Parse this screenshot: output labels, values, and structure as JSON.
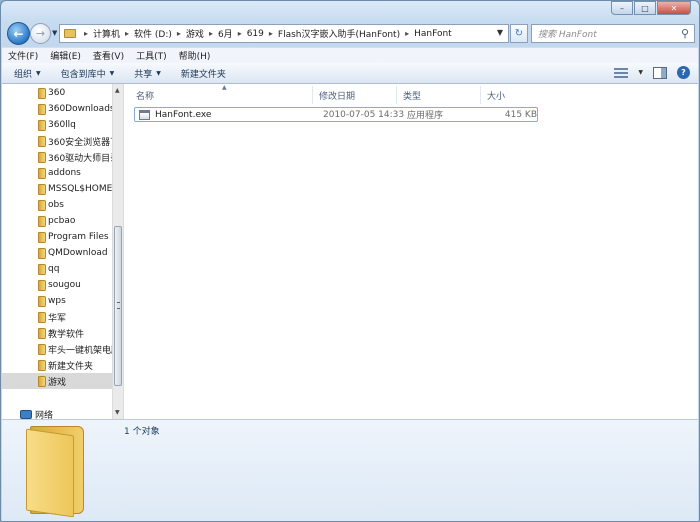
{
  "window": {
    "buttons": {
      "minimize": "–",
      "maximize": "□",
      "close": "✕"
    }
  },
  "address_bar": {
    "crumbs": [
      "计算机",
      "软件 (D:)",
      "游戏",
      "6月",
      "619",
      "Flash汉字嵌入助手(HanFont)",
      "HanFont"
    ]
  },
  "search": {
    "placeholder": "搜索 HanFont"
  },
  "menu": {
    "items": [
      "文件(F)",
      "编辑(E)",
      "查看(V)",
      "工具(T)",
      "帮助(H)"
    ]
  },
  "toolbar": {
    "organize": "组织",
    "include_in_library": "包含到库中",
    "share": "共享",
    "new_folder": "新建文件夹"
  },
  "nav_pane": {
    "items": [
      {
        "label": "360"
      },
      {
        "label": "360Downloads"
      },
      {
        "label": "360llq"
      },
      {
        "label": "360安全浏览器下"
      },
      {
        "label": "360驱动大师目录"
      },
      {
        "label": "addons"
      },
      {
        "label": "MSSQL$HOME"
      },
      {
        "label": "obs"
      },
      {
        "label": "pcbao"
      },
      {
        "label": "Program Files ("
      },
      {
        "label": "QMDownload"
      },
      {
        "label": "qq"
      },
      {
        "label": "sougou"
      },
      {
        "label": "wps"
      },
      {
        "label": "华军"
      },
      {
        "label": "教学软件"
      },
      {
        "label": "牢头一键机架电脑"
      },
      {
        "label": "新建文件夹"
      },
      {
        "label": "游戏",
        "selected": true
      }
    ],
    "network": "网络"
  },
  "columns": {
    "name": "名称",
    "date": "修改日期",
    "type": "类型",
    "size": "大小"
  },
  "files": [
    {
      "name": "HanFont.exe",
      "date": "2010-07-05 14:33",
      "type": "应用程序",
      "size": "415 KB"
    }
  ],
  "details": {
    "count_text": "1 个对象"
  }
}
